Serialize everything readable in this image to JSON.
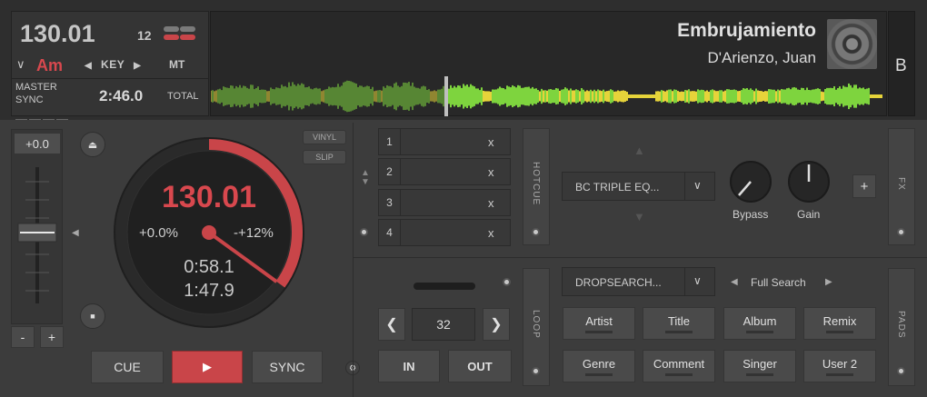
{
  "header": {
    "bpm": "130.01",
    "key_number": "12",
    "key": "Am",
    "key_control": "KEY",
    "mt_label": "MT",
    "master_sync_label": "MASTER\nSYNC",
    "total_time": "2:46.0",
    "total_label": "TOTAL",
    "track_title": "Embrujamiento",
    "track_artist": "D'Arienzo, Juan",
    "deck_letter": "B"
  },
  "pitch": {
    "value": "+0.0",
    "minus_label": "-",
    "plus_label": "+"
  },
  "jog": {
    "bpm": "130.01",
    "pitch_pct": "+0.0%",
    "pitch_range": "-+12%",
    "elapsed": "0:58.1",
    "remaining": "1:47.9",
    "progress": 0.35
  },
  "modes": {
    "vinyl": "VINYL",
    "slip": "SLIP"
  },
  "transport": {
    "cue": "CUE",
    "play": "▶",
    "sync": "SYNC"
  },
  "hotcues": {
    "slots": [
      {
        "num": "1",
        "clear": "x"
      },
      {
        "num": "2",
        "clear": "x"
      },
      {
        "num": "3",
        "clear": "x"
      },
      {
        "num": "4",
        "clear": "x"
      }
    ],
    "tab_label": "HOTCUE"
  },
  "fx": {
    "preset": "BC TRIPLE EQ...",
    "knob1": "Bypass",
    "knob2": "Gain",
    "add": "+",
    "tab_label": "FX"
  },
  "loop": {
    "size": "32",
    "in_label": "IN",
    "out_label": "OUT",
    "tab_label": "LOOP"
  },
  "pads": {
    "dropdown": "DROPSEARCH...",
    "mode": "Full Search",
    "buttons": [
      "Artist",
      "Title",
      "Album",
      "Remix",
      "Genre",
      "Comment",
      "Singer",
      "User 2"
    ],
    "tab_label": "PADS"
  },
  "colors": {
    "accent_red": "#c94549",
    "waveform_green": "#7ed43e",
    "waveform_yellow": "#e6d33a"
  }
}
